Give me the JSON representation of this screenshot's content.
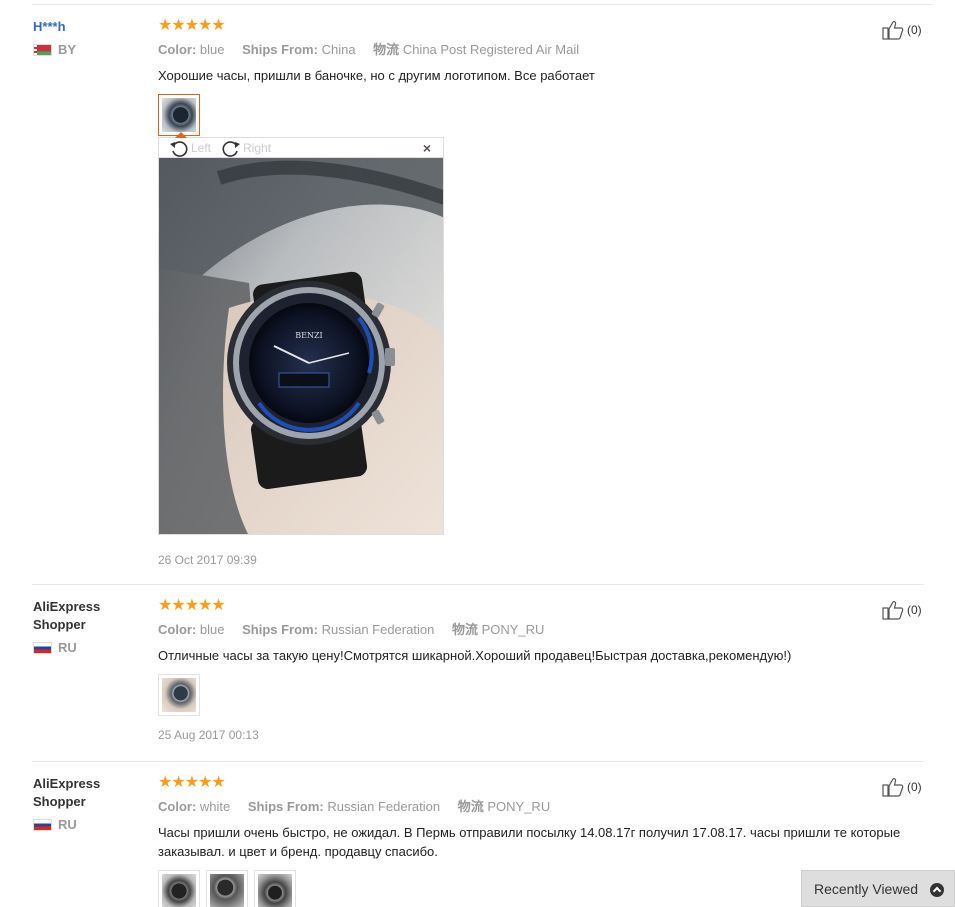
{
  "reviews": [
    {
      "user": "H***h",
      "country": "BY",
      "stars": "★★★★★",
      "color_label": "Color:",
      "color_value": "blue",
      "ships_label": "Ships From:",
      "ships_value": "China",
      "logistics_label": "物流",
      "logistics_value": "China Post Registered Air Mail",
      "feedback": "Хорошие часы, пришли в баночке, но с другим логотипом. Все работает",
      "date": "26 Oct 2017 09:39",
      "helpful": "(0)"
    },
    {
      "user": "AliExpress Shopper",
      "country": "RU",
      "stars": "★★★★★",
      "color_label": "Color:",
      "color_value": "blue",
      "ships_label": "Ships From:",
      "ships_value": "Russian Federation",
      "logistics_label": "物流",
      "logistics_value": "PONY_RU",
      "feedback": "Отличные часы за такую цену!Смотрятся шикарной.Хороший продавец!Быстрая доставка,рекомендую!)",
      "date": "25 Aug 2017 00:13",
      "helpful": "(0)"
    },
    {
      "user": "AliExpress Shopper",
      "country": "RU",
      "stars": "★★★★★",
      "color_label": "Color:",
      "color_value": "white",
      "ships_label": "Ships From:",
      "ships_value": "Russian Federation",
      "logistics_label": "物流",
      "logistics_value": "PONY_RU",
      "feedback": "Часы пришли очень быстро, не ожидал. В Пермь отправили посылку 14.08.17г получил 17.08.17. часы пришли те которые заказывал. и цвет и бренд. продавцу спасибо.",
      "helpful": "(0)"
    }
  ],
  "viewer": {
    "rotate_left": "Left",
    "rotate_right": "Right",
    "close": "×",
    "watch_brand": "BENZI"
  },
  "recently_viewed": "Recently Viewed",
  "colors": {
    "star": "#f99e1a",
    "username_link": "#2d6dbb",
    "active_thumb_border": "#e65e1a"
  }
}
